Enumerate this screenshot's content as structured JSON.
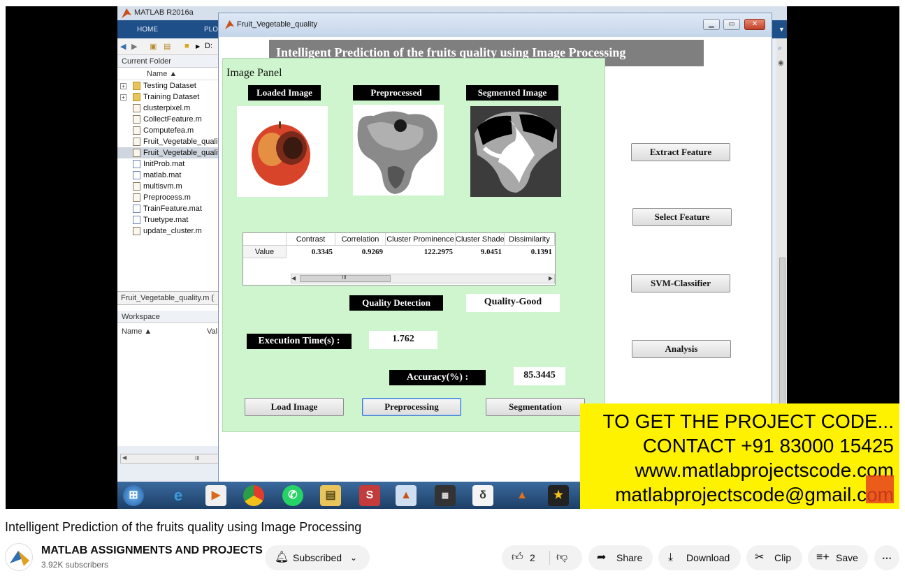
{
  "matlab": {
    "title": "MATLAB R2016a",
    "tabs": [
      "HOME",
      "PLOTS"
    ],
    "path_root": "D:",
    "current_folder_label": "Current Folder",
    "name_col": "Name ▲",
    "files": [
      {
        "name": "Testing Dataset",
        "type": "folder"
      },
      {
        "name": "Training Dataset",
        "type": "folder"
      },
      {
        "name": "clusterpixel.m",
        "type": "m"
      },
      {
        "name": "CollectFeature.m",
        "type": "m"
      },
      {
        "name": "Computefea.m",
        "type": "m"
      },
      {
        "name": "Fruit_Vegetable_quality.fig",
        "type": "m"
      },
      {
        "name": "Fruit_Vegetable_quality.m",
        "type": "m"
      },
      {
        "name": "InitProb.mat",
        "type": "mat"
      },
      {
        "name": "matlab.mat",
        "type": "mat"
      },
      {
        "name": "multisvm.m",
        "type": "m"
      },
      {
        "name": "Preprocess.m",
        "type": "m"
      },
      {
        "name": "TrainFeature.mat",
        "type": "mat"
      },
      {
        "name": "Truetype.mat",
        "type": "mat"
      },
      {
        "name": "update_cluster.m",
        "type": "m"
      }
    ],
    "selected_file": "Fruit_Vegetable_quality.m (",
    "workspace_label": "Workspace",
    "ws_name_col": "Name ▲",
    "ws_val_col": "Val",
    "hscroll_mark": "III"
  },
  "figure": {
    "title": "Fruit_Vegetable_quality",
    "heading": "Intelligent Prediction of the fruits quality using Image Processing",
    "panel_title": "Image Panel",
    "labels": {
      "loaded": "Loaded Image",
      "preprocessed": "Preprocessed",
      "segmented": "Segmented Image",
      "quality_detection": "Quality Detection",
      "execution_time": "Execution Time(s) :",
      "accuracy": "Accuracy(%) :"
    },
    "values": {
      "quality": "Quality-Good",
      "execution_time": "1.762",
      "accuracy": "85.3445"
    },
    "table": {
      "columns": [
        "Contrast",
        "Correlation",
        "Cluster Prominence",
        "Cluster Shade",
        "Dissimilarity"
      ],
      "row_label": "Value",
      "values": [
        "0.3345",
        "0.9269",
        "122.2975",
        "9.0451",
        "0.1391"
      ],
      "scroll_mark": "III"
    },
    "buttons": {
      "load": "Load Image",
      "preprocess": "Preprocessing",
      "segment": "Segmentation",
      "extract": "Extract Feature",
      "select": "Select Feature",
      "svm": "SVM-Classifier",
      "analysis": "Analysis"
    }
  },
  "promo": {
    "line1": "TO GET THE PROJECT CODE...",
    "line2": "CONTACT +91 83000 15425",
    "line3": "www.matlabprojectscode.com",
    "line4": "matlabprojectscode@gmail.com"
  },
  "video": {
    "title": "Intelligent Prediction of the fruits quality using Image Processing",
    "channel": "MATLAB ASSIGNMENTS AND PROJECTS",
    "subscribers": "3.92K subscribers",
    "subscribe_label": "Subscribed",
    "likes": "2",
    "share": "Share",
    "download": "Download",
    "clip": "Clip",
    "save": "Save"
  }
}
